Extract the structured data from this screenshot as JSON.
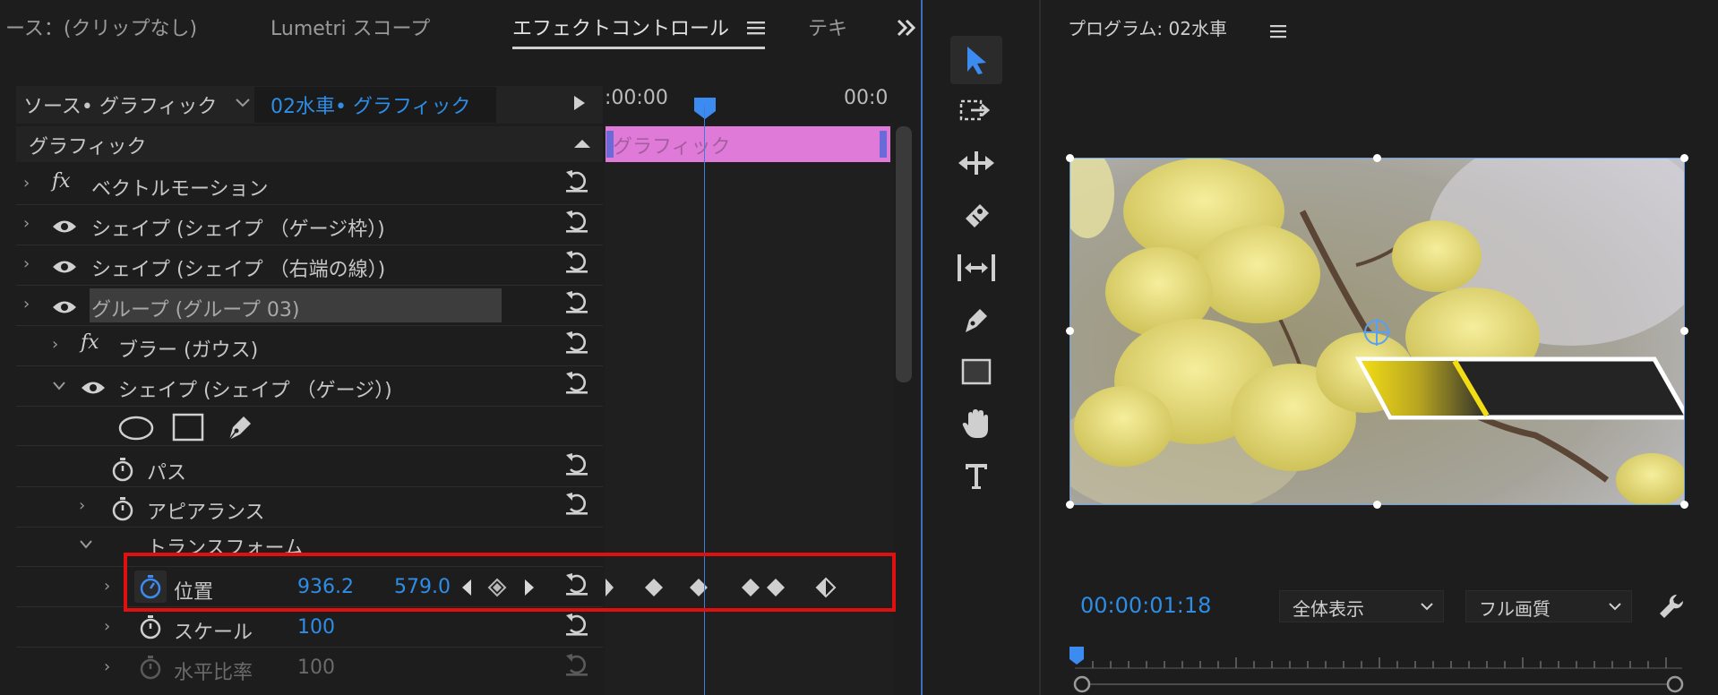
{
  "tabs": [
    {
      "label": "ース：(クリップなし)"
    },
    {
      "label": "Lumetri スコープ"
    },
    {
      "label": "エフェクトコントロール"
    },
    {
      "label": "テキ"
    }
  ],
  "header": {
    "source_label": "ソース• グラフィック",
    "clip_label": "02水車• グラフィック",
    "timecode_start": ":00:00",
    "timecode_end": "00:0"
  },
  "section": {
    "title": "グラフィック"
  },
  "clip_bar_label": "グラフィック",
  "effects": [
    {
      "label": "ベクトルモーション"
    },
    {
      "label": "シェイプ (シェイプ （ゲージ枠）)"
    },
    {
      "label": "シェイプ (シェイプ （右端の線）)"
    },
    {
      "label": "グループ (グループ 03)"
    },
    {
      "label": "ブラー (ガウス)"
    },
    {
      "label": "シェイプ (シェイプ （ゲージ）)"
    }
  ],
  "properties": {
    "path": "パス",
    "appearance": "アピアランス",
    "transform": "トランスフォーム",
    "position": {
      "label": "位置",
      "x": "936.2",
      "y": "579.0"
    },
    "scale": {
      "label": "スケール",
      "value": "100"
    },
    "hscale": {
      "label": "水平比率",
      "value": "100"
    }
  },
  "monitor": {
    "title": "プログラム: 02水車",
    "timecode": "00:00:01:18",
    "fit_option": "全体表示",
    "quality_option": "フル画質"
  },
  "colors": {
    "accent": "#2e8de6",
    "clip": "#e07ad8",
    "highlight": "#e01010",
    "gauge_yellow": "#f2dc16"
  }
}
